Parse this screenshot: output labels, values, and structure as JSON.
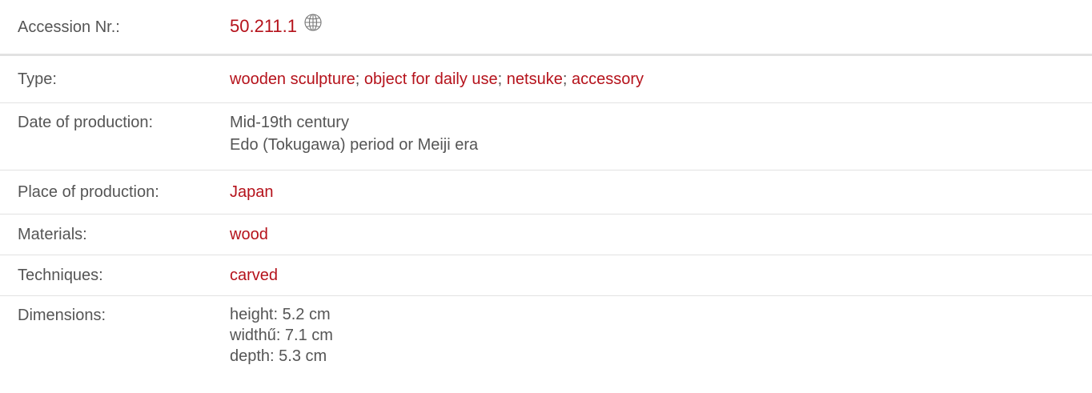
{
  "rows": {
    "accession": {
      "label": "Accession Nr.:",
      "value": "50.211.1",
      "icon": "globe-icon"
    },
    "type": {
      "label": "Type:",
      "values": [
        "wooden sculpture",
        "object for daily use",
        "netsuke",
        "accessory"
      ],
      "separator": ";"
    },
    "date": {
      "label": "Date of production:",
      "lines": [
        "Mid-19th century",
        "Edo (Tokugawa) period or Meiji era"
      ]
    },
    "place": {
      "label": "Place of production:",
      "value": "Japan"
    },
    "materials": {
      "label": "Materials:",
      "value": "wood"
    },
    "techniques": {
      "label": "Techniques:",
      "value": "carved"
    },
    "dimensions": {
      "label": "Dimensions:",
      "lines": [
        "height: 5.2 cm",
        "widthű: 7.1 cm",
        "depth: 5.3 cm"
      ]
    }
  },
  "colors": {
    "link": "#b5121b",
    "text": "#555555",
    "divider": "#e2e2e2"
  }
}
